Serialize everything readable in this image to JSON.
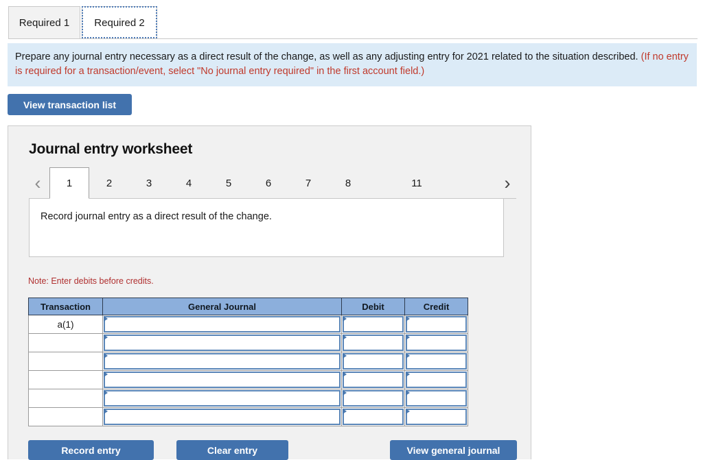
{
  "required_tabs": [
    {
      "label": "Required 1",
      "active": false
    },
    {
      "label": "Required 2",
      "active": true
    }
  ],
  "instructions": {
    "main": "Prepare any journal entry necessary as a direct result of the change, as well as any adjusting entry for 2021 related to the situation described.",
    "parenthetical": "(If no entry is required for a transaction/event, select \"No journal entry required\" in the first account field.)"
  },
  "toolbar": {
    "view_transaction_list_label": "View transaction list"
  },
  "worksheet": {
    "title": "Journal entry worksheet",
    "pager": {
      "prev_icon": "chevron-left-icon",
      "next_icon": "chevron-right-icon",
      "prev_glyph": "‹",
      "next_glyph": "›",
      "pages": [
        "1",
        "2",
        "3",
        "4",
        "5",
        "6",
        "7",
        "8",
        "11"
      ],
      "active_page": "1"
    },
    "description": "Record journal entry as a direct result of the change.",
    "note": "Note: Enter debits before credits.",
    "table": {
      "headers": [
        "Transaction",
        "General Journal",
        "Debit",
        "Credit"
      ],
      "rows": [
        {
          "transaction": "a(1)",
          "general_journal": "",
          "debit": "",
          "credit": ""
        },
        {
          "transaction": "",
          "general_journal": "",
          "debit": "",
          "credit": ""
        },
        {
          "transaction": "",
          "general_journal": "",
          "debit": "",
          "credit": ""
        },
        {
          "transaction": "",
          "general_journal": "",
          "debit": "",
          "credit": ""
        },
        {
          "transaction": "",
          "general_journal": "",
          "debit": "",
          "credit": ""
        },
        {
          "transaction": "",
          "general_journal": "",
          "debit": "",
          "credit": ""
        }
      ]
    },
    "footer_buttons": {
      "record_entry_label": "Record entry",
      "clear_entry_label": "Clear entry",
      "view_general_journal_label": "View general journal"
    }
  },
  "colors": {
    "accent_blue": "#4272ad",
    "banner_blue": "#dcebf7",
    "table_header_blue": "#8cafdc",
    "note_red": "#b03030",
    "input_border_blue": "#5a86b8",
    "panel_gray": "#f1f1f1"
  }
}
